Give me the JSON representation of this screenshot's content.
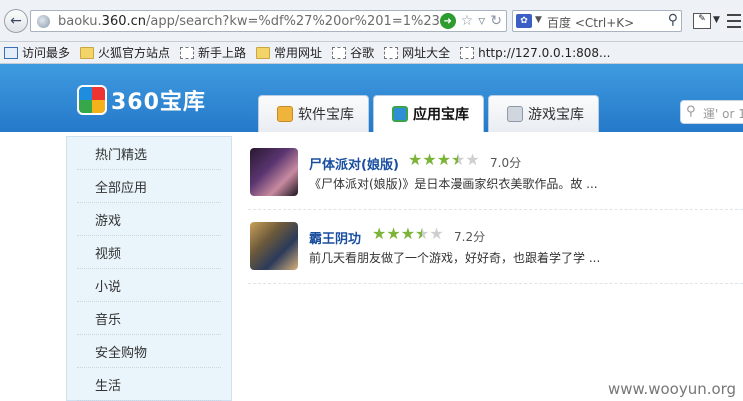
{
  "browser": {
    "url_dim_prefix": "baoku.",
    "url_host": "360.cn",
    "url_path": "/app/search?kw=%df%27%20or%201=1%23",
    "search_text": "百度 <Ctrl+K>"
  },
  "bookmarks": [
    {
      "label": "访问最多",
      "icon": "star-icon"
    },
    {
      "label": "火狐官方站点",
      "icon": "folder-icon"
    },
    {
      "label": "新手上路",
      "icon": "page-icon"
    },
    {
      "label": "常用网址",
      "icon": "folder-icon"
    },
    {
      "label": "谷歌",
      "icon": "page-icon"
    },
    {
      "label": "网址大全",
      "icon": "page-icon"
    },
    {
      "label": "http://127.0.0.1:808...",
      "icon": "page-icon"
    }
  ],
  "header": {
    "logo_text": "360宝库",
    "tabs": [
      {
        "label": "软件宝库",
        "active": false
      },
      {
        "label": "应用宝库",
        "active": true
      },
      {
        "label": "游戏宝库",
        "active": false
      }
    ],
    "search_placeholder": "運' or 1"
  },
  "sidebar": {
    "items": [
      "热门精选",
      "全部应用",
      "游戏",
      "视频",
      "小说",
      "音乐",
      "安全购物",
      "生活"
    ]
  },
  "results": [
    {
      "title": "尸体派对(娘版)",
      "rating": 3.5,
      "score": "7.0分",
      "description": "《尸体派对(娘版)》是日本漫画家织衣美歌作品。故 ..."
    },
    {
      "title": "霸王阴功",
      "rating": 3.5,
      "score": "7.2分",
      "description": "前几天看朋友做了一个游戏，好好奇，也跟着学了学 ..."
    }
  ],
  "watermark": "www.wooyun.org",
  "colors": {
    "header_blue": "#2f8ad6",
    "star_green": "#7cb43a",
    "title_blue": "#1a4fa0"
  }
}
